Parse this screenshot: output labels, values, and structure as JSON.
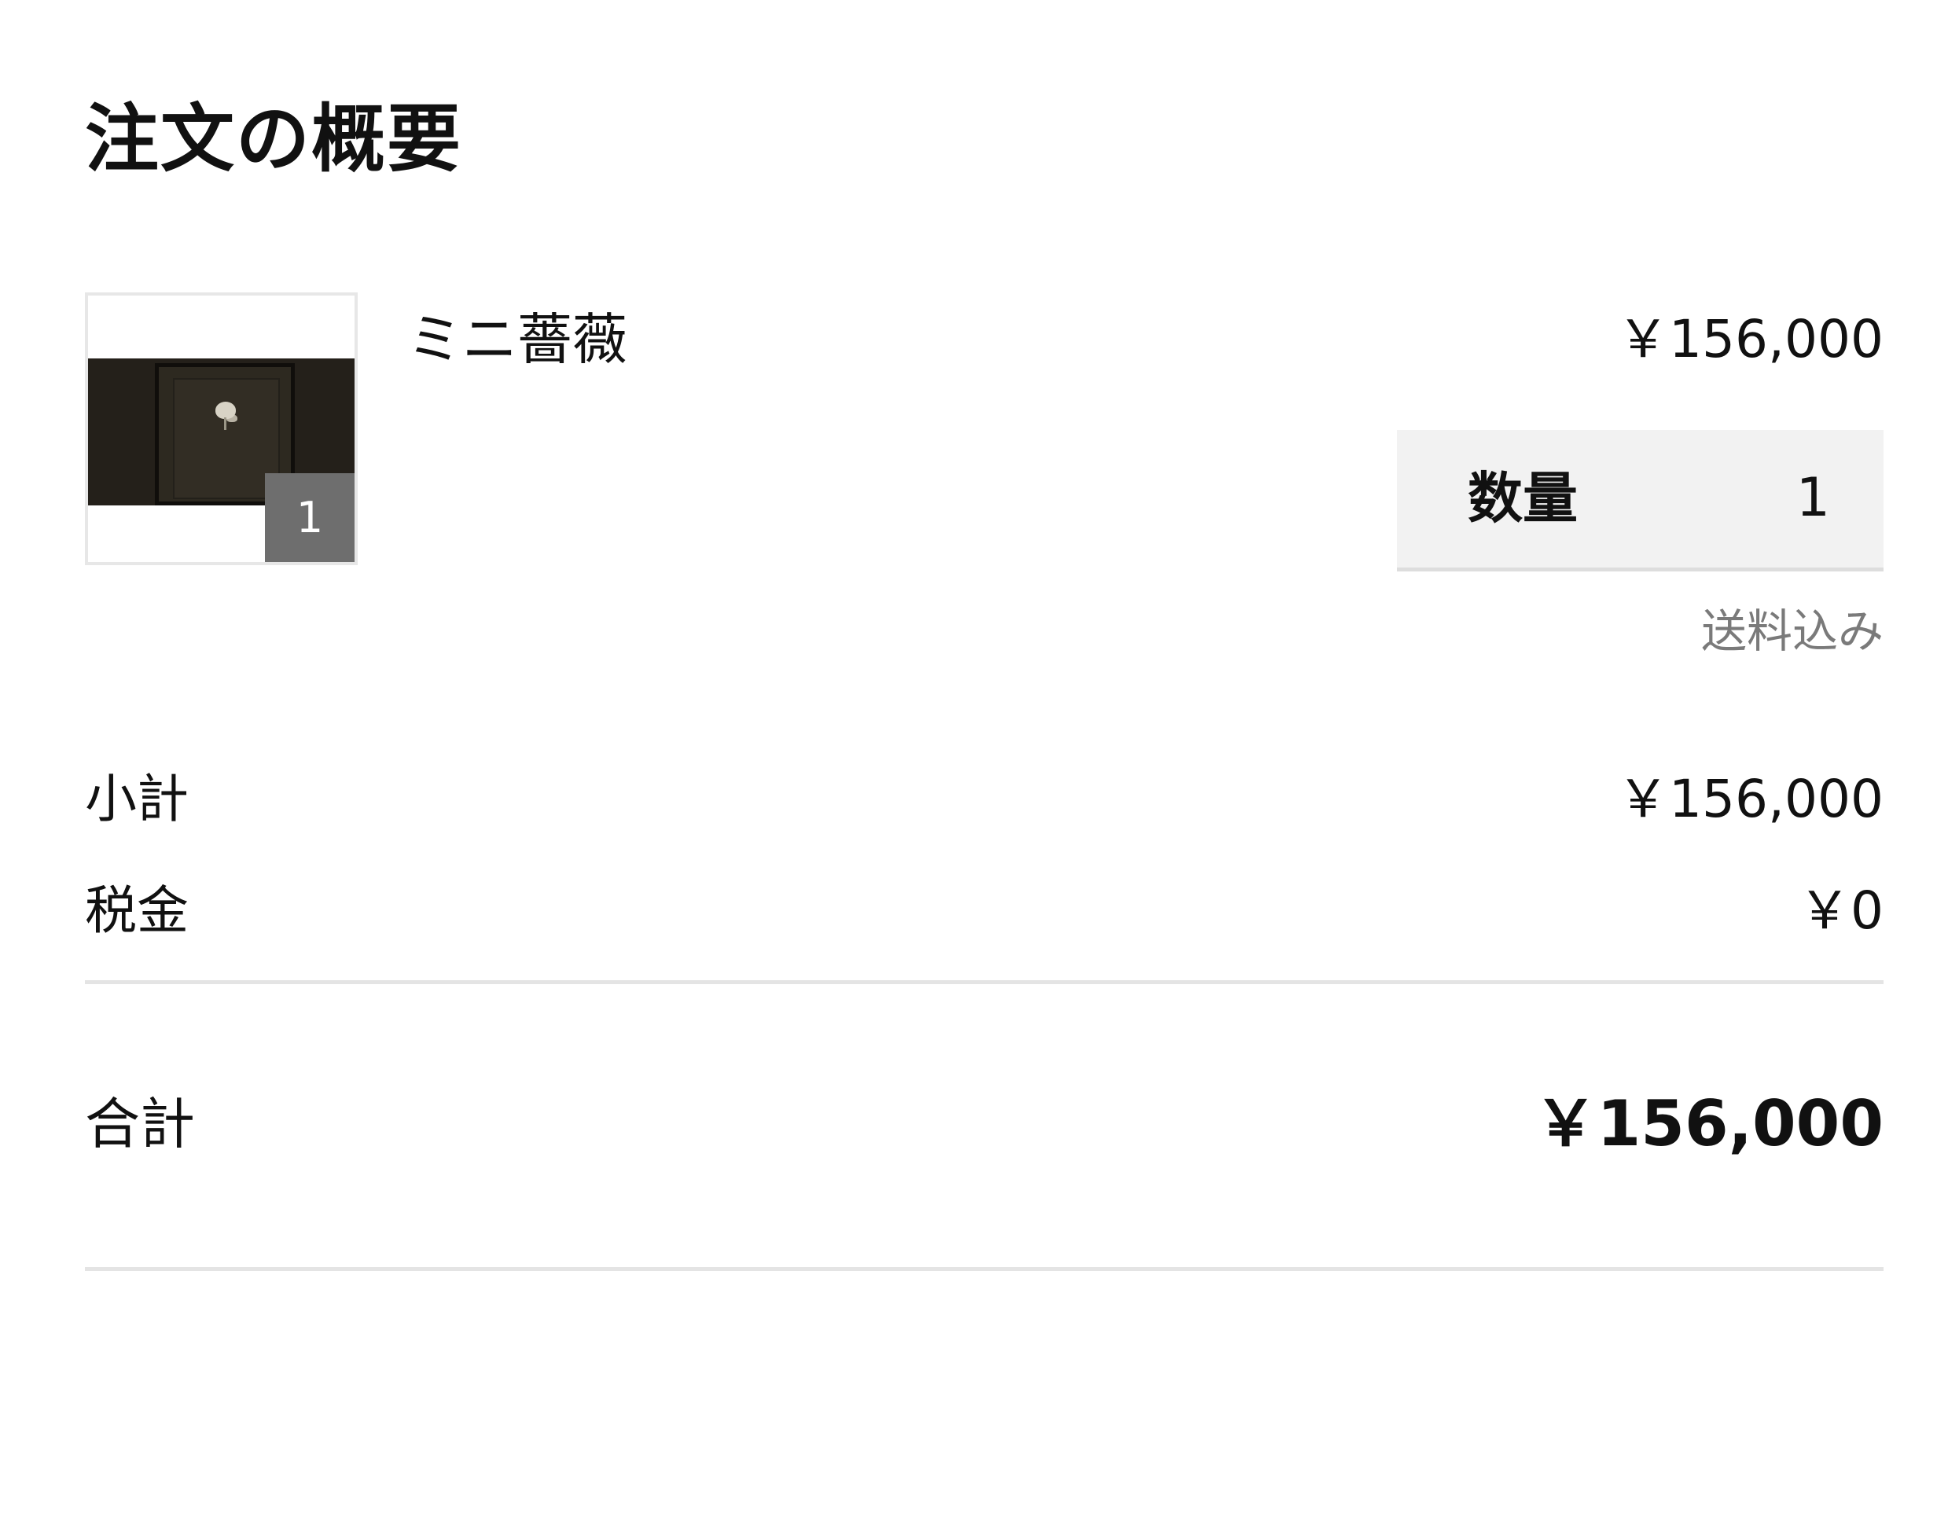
{
  "order_summary": {
    "title": "注文の概要",
    "item": {
      "image_badge": "1",
      "name": "ミニ薔薇",
      "price": "￥156,000",
      "quantity_label": "数量",
      "quantity_value": "1",
      "shipping_note": "送料込み"
    },
    "subtotal": {
      "label": "小計",
      "value": "￥156,000"
    },
    "tax": {
      "label": "税金",
      "value": "￥0"
    },
    "total": {
      "label": "合計",
      "value": "￥156,000"
    }
  }
}
